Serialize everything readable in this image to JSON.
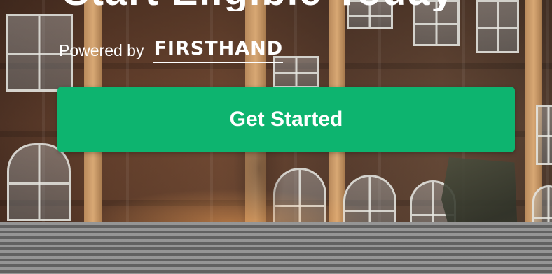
{
  "hero": {
    "title_partial": "Start Eligible Today",
    "powered_by_label": "Powered by",
    "brand_name": "FIRSTHAND"
  },
  "cta": {
    "label": "Get Started",
    "color": "#0db46f"
  }
}
